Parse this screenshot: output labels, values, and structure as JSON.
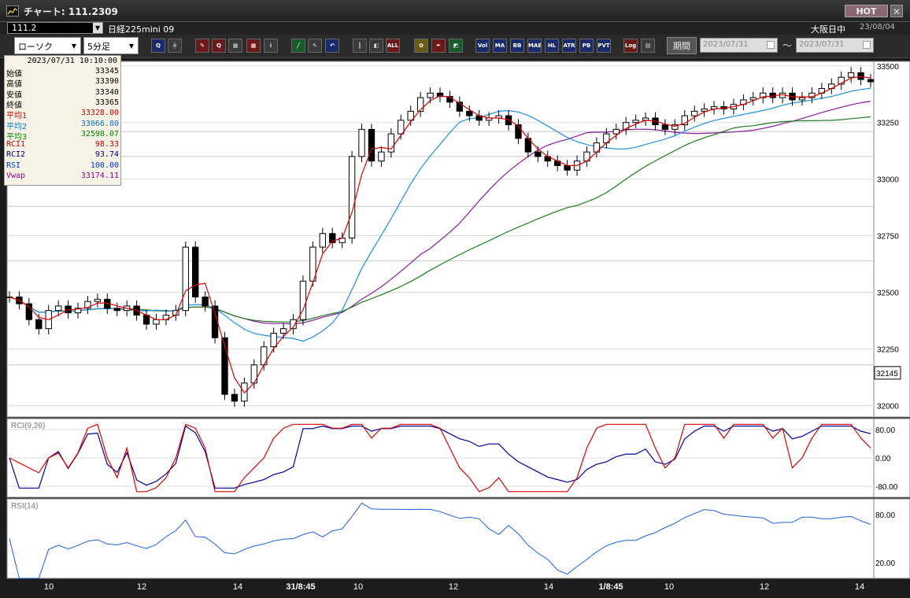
{
  "window": {
    "title": "チャート: 111.2309",
    "hot_label": "HOT",
    "close_label": "✕"
  },
  "header": {
    "symbol_code": "111.2",
    "instrument": "日経225mini 09",
    "session": "大阪日中",
    "date": "23/08/04"
  },
  "toolbar": {
    "chart_type": "ローソク",
    "timeframe": "5分足",
    "period_label": "期間",
    "date_from": "2023/07/31",
    "date_to": "2023/07/31",
    "tilde": "〜",
    "buttons": [
      "zoom-in",
      "bar",
      "drawing",
      "range",
      "crosshair",
      "grid",
      "grid2",
      "info",
      "line",
      "arrow",
      "undo",
      "candle",
      "box",
      "all",
      "gear",
      "pen",
      "color",
      "vol",
      "MA",
      "BB",
      "MAE",
      "HL",
      "ATR",
      "PB",
      "PVT",
      "Log",
      "table"
    ]
  },
  "info": {
    "timestamp": "2023/07/31  10:10:00",
    "rows": [
      {
        "k": "始値",
        "v": "33345",
        "c": "#000000"
      },
      {
        "k": "高値",
        "v": "33390",
        "c": "#000000"
      },
      {
        "k": "安値",
        "v": "33340",
        "c": "#000000"
      },
      {
        "k": "終値",
        "v": "33365",
        "c": "#000000"
      },
      {
        "k": "平均1",
        "v": "33328.00",
        "c": "#cc0000"
      },
      {
        "k": "平均2",
        "v": "33066.80",
        "c": "#0077cc"
      },
      {
        "k": "平均3",
        "v": "32598.07",
        "c": "#008800"
      },
      {
        "k": "RCI1",
        "v": "98.33",
        "c": "#cc0000"
      },
      {
        "k": "RCI2",
        "v": "93.74",
        "c": "#000088"
      },
      {
        "k": "RSI",
        "v": "100.00",
        "c": "#0033cc"
      },
      {
        "k": "Vwap",
        "v": "33174.11",
        "c": "#880088"
      }
    ]
  },
  "colors": {
    "ma1": "#dd0000",
    "ma2": "#1f8fe0",
    "ma3": "#1e7a1e",
    "vwap": "#8a1aa0",
    "rci1": "#dd0000",
    "rci2": "#000099",
    "rsi": "#1f5fe0"
  },
  "chart_data": [
    {
      "type": "candlestick",
      "title": "",
      "current_price_label": "32145",
      "ylim": [
        31950,
        33520
      ],
      "y_ticks": [
        "33500",
        "33250",
        "33000",
        "32750",
        "32500",
        "32250",
        "32000"
      ],
      "x_tick_labels": [
        "10",
        "12",
        "14",
        "31/8:45",
        "10",
        "12",
        "14",
        "1/8:45",
        "10",
        "12",
        "14"
      ],
      "series": [
        {
          "name": "平均1"
        },
        {
          "name": "平均2"
        },
        {
          "name": "平均3"
        },
        {
          "name": "Vwap"
        }
      ],
      "close_approx": [
        32480,
        32450,
        32380,
        32340,
        32420,
        32440,
        32410,
        32430,
        32460,
        32470,
        32430,
        32420,
        32440,
        32400,
        32360,
        32380,
        32400,
        32420,
        32700,
        32480,
        32440,
        32300,
        32050,
        32020,
        32100,
        32180,
        32260,
        32320,
        32340,
        32380,
        32550,
        32700,
        32760,
        32720,
        32740,
        33100,
        33220,
        33080,
        33120,
        33200,
        33260,
        33300,
        33360,
        33380,
        33365,
        33340,
        33300,
        33280,
        33260,
        33270,
        33280,
        33240,
        33180,
        33120,
        33100,
        33080,
        33060,
        33040,
        33080,
        33120,
        33160,
        33200,
        33220,
        33250,
        33260,
        33270,
        33240,
        33220,
        33240,
        33280,
        33300,
        33310,
        33320,
        33310,
        33330,
        33350,
        33360,
        33380,
        33360,
        33380,
        33350,
        33360,
        33380,
        33400,
        33420,
        33450,
        33470,
        33440,
        33430
      ]
    },
    {
      "type": "line",
      "title": "RCI(9,26)",
      "ylim": [
        -100,
        100
      ],
      "y_ticks": [
        "80.00",
        "0.00",
        "-80.00"
      ],
      "series": [
        {
          "name": "RCI1"
        },
        {
          "name": "RCI2"
        }
      ]
    },
    {
      "type": "line",
      "title": "RSI(14)",
      "ylim": [
        0,
        100
      ],
      "y_ticks": [
        "80.00",
        "20.00"
      ],
      "series": [
        {
          "name": "RSI"
        }
      ]
    }
  ]
}
